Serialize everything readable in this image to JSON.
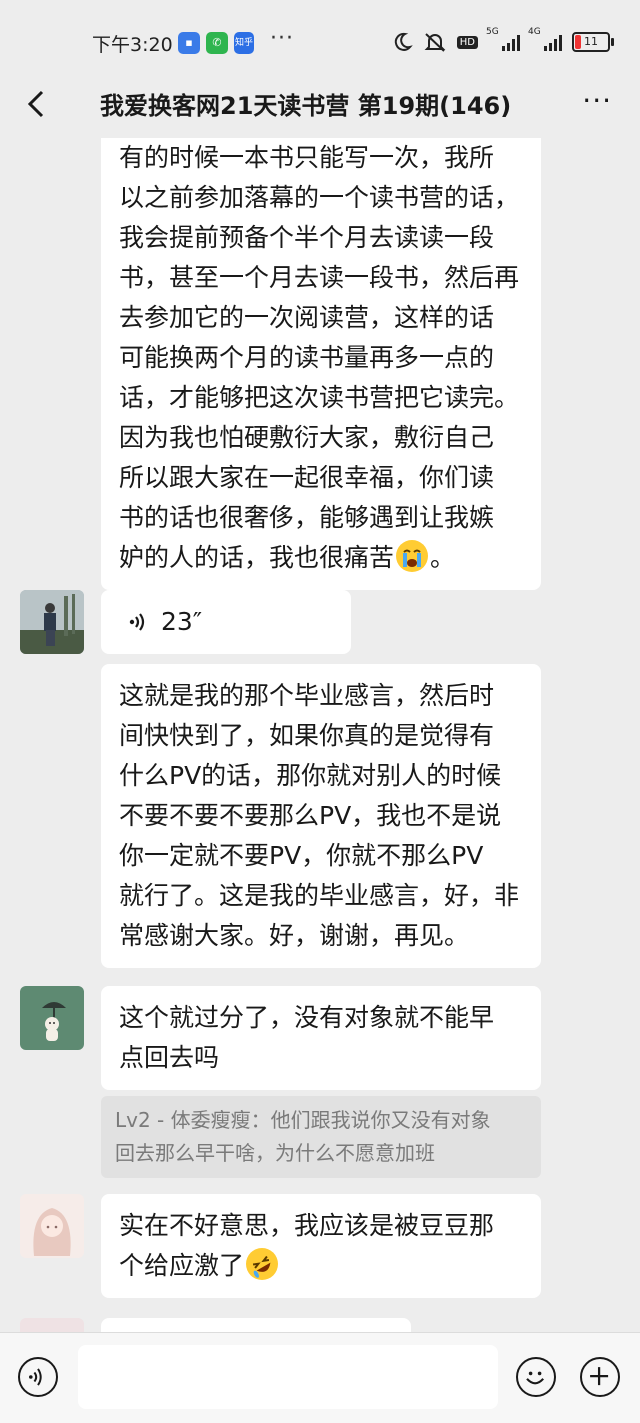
{
  "status_bar": {
    "time": "下午3:20",
    "app_icon_zhihu": "知乎",
    "dots": "···",
    "network_5g": "5G",
    "network_4g": "4G",
    "hd": "HD",
    "battery": "11"
  },
  "header": {
    "title": "我爱换客网21天读书营 第19期(146)",
    "more": "···"
  },
  "messages": [
    {
      "text": "有的时候一本书只能写一次，我所\n以之前参加落幕的一个读书营的话，\n我会提前预备个半个月去读读一段\n书，甚至一个月去读一段书，然后再\n去参加它的一次阅读营，这样的话\n可能换两个月的读书量再多一点的\n话，才能够把这次读书营把它读完。\n因为我也怕硬敷衍大家，敷衍自己\n所以跟大家在一起很幸福，你们读\n书的话也很奢侈，能够遇到让我嫉\n妒的人的话，我也很痛苦",
      "trailing": "。"
    },
    {
      "voice_duration": "23″"
    },
    {
      "text": "这就是我的那个毕业感言，然后时\n间快快到了，如果你真的是觉得有\n什么PV的话，那你就对别人的时候\n不要不要不要那么PV，我也不是说\n你一定就不要PV，你就不那么PV\n就行了。这是我的毕业感言，好，非\n常感谢大家。好，谢谢，再见。"
    },
    {
      "text": "这个就过分了，没有对象就不能早\n点回去吗",
      "quote": "Lv2 - 体委瘦瘦：他们跟我说你又没有对象\n回去那么早干啥，为什么不愿意加班"
    },
    {
      "text": "实在不好意思，我应该是被豆豆那\n个给应激了"
    }
  ],
  "icons": {
    "crying_emoji": "loudly-crying-face",
    "laughing_emoji": "rolling-on-floor-laughing",
    "voice": "voice-wave-icon",
    "emoji_button": "smiley-icon",
    "plus_button": "plus-icon"
  },
  "colors": {
    "background": "#ededed",
    "bubble": "#ffffff",
    "quote": "#e1e1e1",
    "input_bar": "#f7f7f7"
  }
}
